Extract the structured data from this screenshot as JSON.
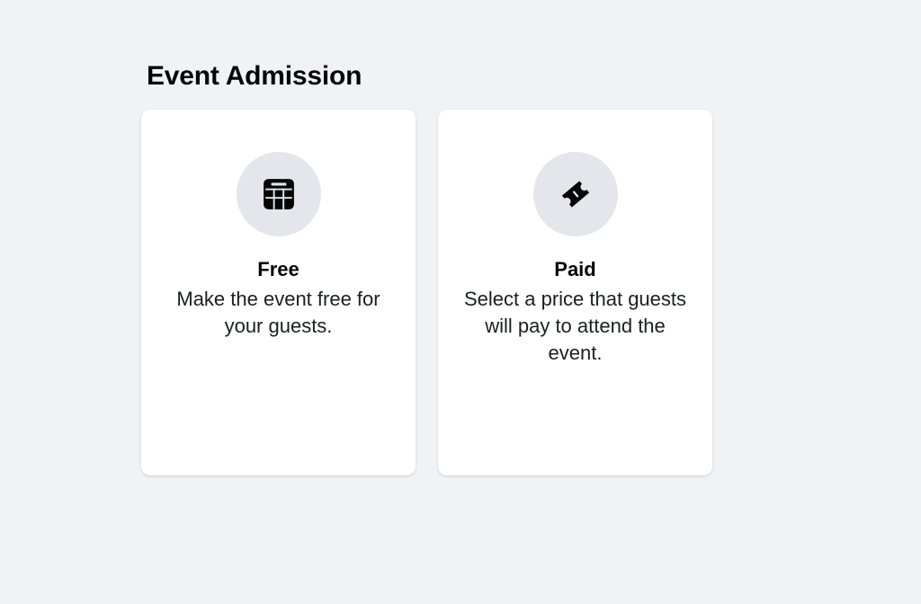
{
  "page": {
    "title": "Event Admission"
  },
  "options": [
    {
      "title": "Free",
      "description": "Make the event free for your guests.",
      "icon": "calendar-icon"
    },
    {
      "title": "Paid",
      "description": "Select a price that guests will pay to attend the event.",
      "icon": "ticket-icon"
    }
  ],
  "colors": {
    "background": "#f0f2f5",
    "card": "#ffffff",
    "icon_circle": "#e4e6eb",
    "icon": "#050505",
    "text": "#050505"
  }
}
